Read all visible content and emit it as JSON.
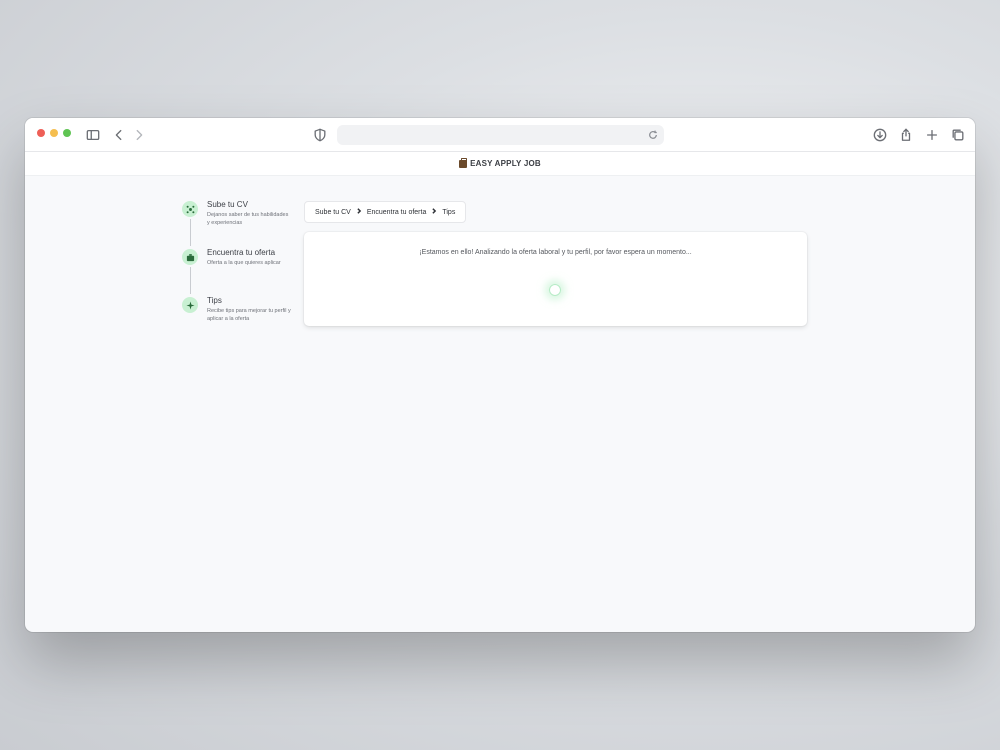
{
  "brand": {
    "name": "EASY APPLY JOB",
    "icon": "briefcase-icon"
  },
  "browser": {
    "icons": [
      "sidebar-icon",
      "back-icon",
      "forward-icon",
      "shield-icon",
      "reload-icon",
      "download-icon",
      "share-icon",
      "new-tab-icon",
      "tabs-icon"
    ]
  },
  "steps": [
    {
      "title": "Sube tu CV",
      "description": "Dejanos saber de tus habilidades y experiencias",
      "icon": "network-icon"
    },
    {
      "title": "Encuentra tu oferta",
      "description": "Oferta a la que quieres aplicar",
      "icon": "briefcase-icon"
    },
    {
      "title": "Tips",
      "description": "Recibe tips para mejorar tu perfil y aplicar a la oferta",
      "icon": "sparkle-icon"
    }
  ],
  "breadcrumb": {
    "items": [
      "Sube tu CV",
      "Encuentra tu oferta",
      "Tips"
    ]
  },
  "status": {
    "message": "¡Estamos en ello! Analizando la oferta laboral y tu perfil, por favor espera un momento..."
  },
  "colors": {
    "accent_green": "#c8f0d2",
    "spinner_green": "#b5ebc5"
  }
}
